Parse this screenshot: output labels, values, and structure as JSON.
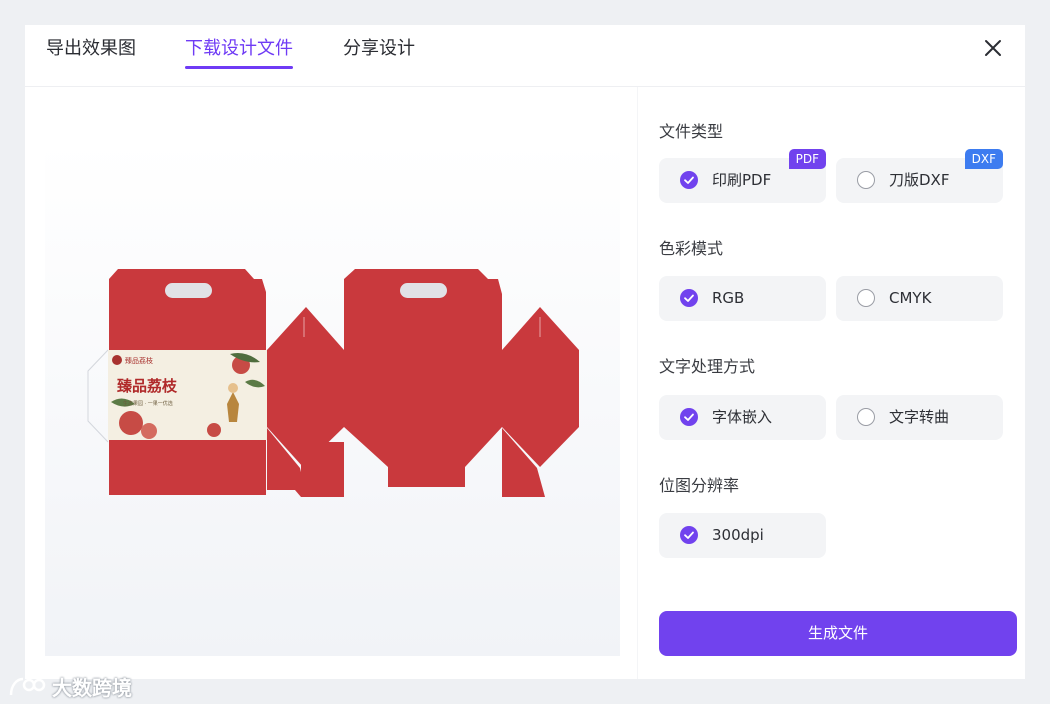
{
  "tabs": [
    {
      "label": "导出效果图",
      "active": false
    },
    {
      "label": "下载设计文件",
      "active": true
    },
    {
      "label": "分享设计",
      "active": false
    }
  ],
  "close_icon": "close-icon",
  "preview": {
    "package_brand": "臻品荔枝",
    "package_title": "臻品荔枝",
    "package_slogan": "生态果园 · 一果一优选"
  },
  "sections": {
    "file_type": {
      "label": "文件类型",
      "options": [
        {
          "label": "印刷PDF",
          "checked": true,
          "badge": "PDF",
          "badge_color": "#7142ee"
        },
        {
          "label": "刀版DXF",
          "checked": false,
          "badge": "DXF",
          "badge_color": "#3d7cf0"
        }
      ]
    },
    "color_mode": {
      "label": "色彩模式",
      "options": [
        {
          "label": "RGB",
          "checked": true
        },
        {
          "label": "CMYK",
          "checked": false
        }
      ]
    },
    "text_mode": {
      "label": "文字处理方式",
      "options": [
        {
          "label": "字体嵌入",
          "checked": true
        },
        {
          "label": "文字转曲",
          "checked": false
        }
      ]
    },
    "resolution": {
      "label": "位图分辨率",
      "options": [
        {
          "label": "300dpi",
          "checked": true
        }
      ]
    }
  },
  "generate_button": "生成文件",
  "watermark": "大数跨境",
  "colors": {
    "accent": "#7142ee",
    "box_red": "#c9393d",
    "option_bg": "#f3f4f6"
  }
}
